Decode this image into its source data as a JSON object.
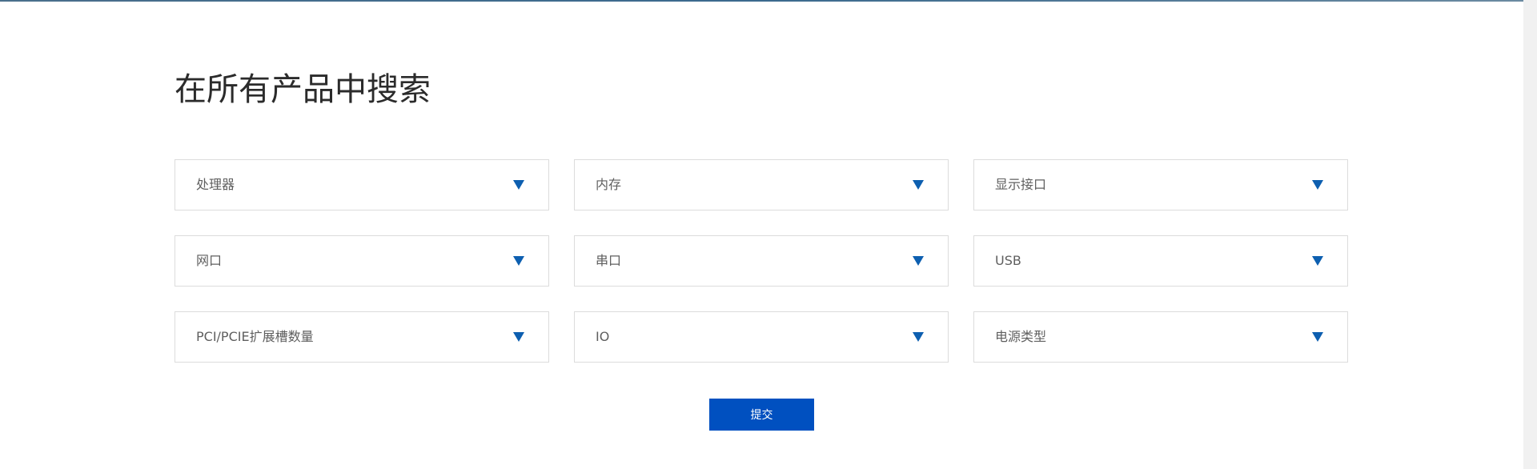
{
  "page": {
    "title": "在所有产品中搜索"
  },
  "filters": [
    {
      "label": "处理器",
      "icon": "caret-down-icon"
    },
    {
      "label": "内存",
      "icon": "caret-down-icon"
    },
    {
      "label": "显示接口",
      "icon": "caret-down-icon"
    },
    {
      "label": "网口",
      "icon": "caret-down-icon"
    },
    {
      "label": "串口",
      "icon": "caret-down-icon"
    },
    {
      "label": "USB",
      "icon": "caret-down-icon"
    },
    {
      "label": "PCI/PCIE扩展槽数量",
      "icon": "caret-down-icon"
    },
    {
      "label": "IO",
      "icon": "caret-down-icon"
    },
    {
      "label": "电源类型",
      "icon": "caret-down-icon"
    }
  ],
  "submit": {
    "label": "提交"
  },
  "colors": {
    "accent": "#0d5fb0",
    "button": "#0050c0",
    "border": "#dcdcdc",
    "title": "#2b2b2b",
    "label": "#5f5f5f"
  }
}
